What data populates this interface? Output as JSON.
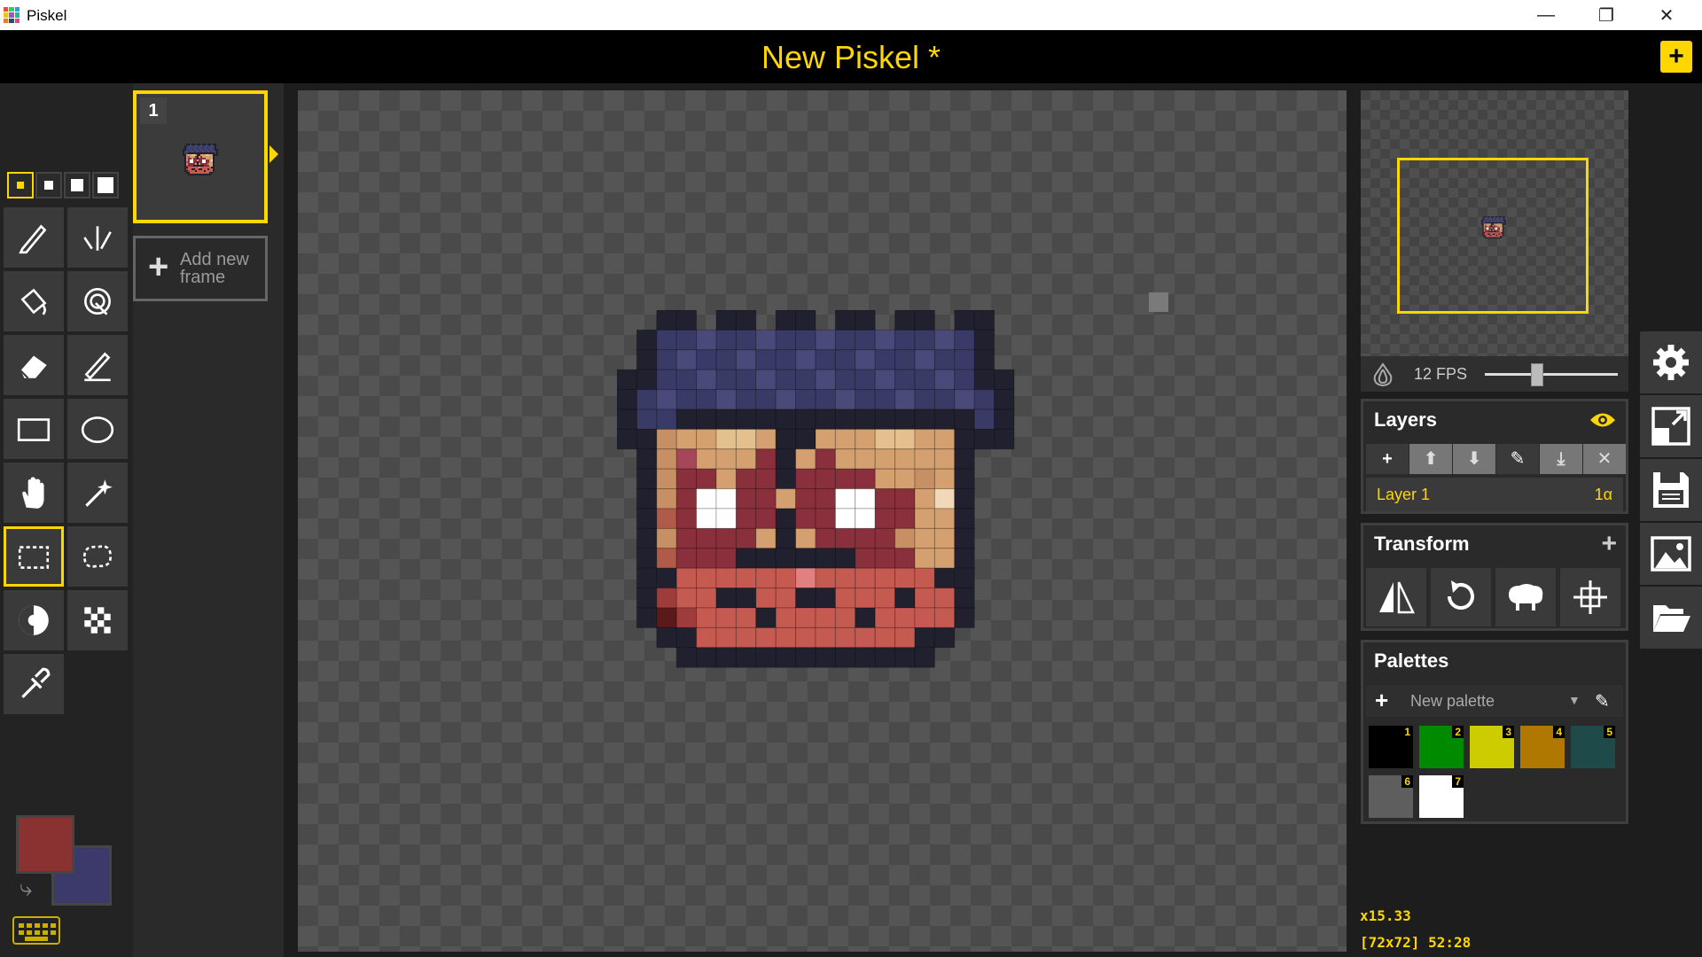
{
  "window": {
    "title": "Piskel",
    "controls": [
      "—",
      "❐",
      "✕"
    ]
  },
  "header": {
    "title": "New Piskel *",
    "new_button": "+"
  },
  "tools": {
    "pen_sizes": [
      1,
      2,
      3,
      4
    ],
    "selected_pen_size": 1,
    "items": [
      {
        "name": "pen-tool",
        "icon": "pen-icon"
      },
      {
        "name": "vertical-mirror-pen-tool",
        "icon": "mirror-pen-icon"
      },
      {
        "name": "paint-bucket-tool",
        "icon": "bucket-icon"
      },
      {
        "name": "paint-same-pixels-tool",
        "icon": "magic-bucket-icon"
      },
      {
        "name": "eraser-tool",
        "icon": "eraser-icon"
      },
      {
        "name": "stroke-tool",
        "icon": "stroke-icon"
      },
      {
        "name": "rectangle-tool",
        "icon": "rectangle-icon"
      },
      {
        "name": "circle-tool",
        "icon": "circle-icon"
      },
      {
        "name": "move-tool",
        "icon": "hand-icon"
      },
      {
        "name": "shape-selection-tool",
        "icon": "magic-wand-icon"
      },
      {
        "name": "rectangle-selection-tool",
        "icon": "rect-select-icon"
      },
      {
        "name": "lasso-selection-tool",
        "icon": "lasso-icon"
      },
      {
        "name": "lighten-tool",
        "icon": "lighten-icon"
      },
      {
        "name": "dithering-tool",
        "icon": "checker-icon"
      },
      {
        "name": "color-picker-tool",
        "icon": "eyedropper-icon"
      }
    ],
    "selected_tool": "rectangle-selection-tool",
    "primary_color": "#8a3232",
    "secondary_color": "#3b3a6b"
  },
  "frames": {
    "items": [
      {
        "number": "1"
      }
    ],
    "add_label_line1": "Add new",
    "add_label_line2": "frame"
  },
  "preview": {
    "fps_label": "12 FPS",
    "fps": 12
  },
  "layers": {
    "title": "Layers",
    "items": [
      {
        "name": "Layer 1",
        "opacity": "1α"
      }
    ]
  },
  "transform": {
    "title": "Transform",
    "tools": [
      "flip-icon",
      "rotate-icon",
      "clone-icon",
      "center-icon"
    ]
  },
  "palettes": {
    "title": "Palettes",
    "selected": "New palette",
    "colors": [
      {
        "n": "1",
        "hex": "#000000"
      },
      {
        "n": "2",
        "hex": "#008a00"
      },
      {
        "n": "3",
        "hex": "#cccc00"
      },
      {
        "n": "4",
        "hex": "#b07800"
      },
      {
        "n": "5",
        "hex": "#1f4a4a"
      },
      {
        "n": "6",
        "hex": "#5e5e5e"
      },
      {
        "n": "7",
        "hex": "#ffffff"
      }
    ]
  },
  "status": {
    "zoom": "x15.33",
    "cursor": "[72x72] 52:28"
  },
  "side_actions": [
    "settings-icon",
    "resize-icon",
    "save-icon",
    "export-image-icon",
    "open-folder-icon"
  ],
  "sprite": {
    "palette": {
      "K": "#20202f",
      "N": "#3a3a66",
      "M": "#4a4a7a",
      "S": "#d4a070",
      "T": "#c79064",
      "L": "#e3c08e",
      "R": "#8a2f3c",
      "P": "#a5465a",
      "W": "#ffffff",
      "O": "#b05a4a",
      "E": "#c45a50",
      "D": "#9e3c3c",
      "B": "#5a1a1a",
      "F": "#e28080",
      "G": "#f0d8b8"
    },
    "rows": [
      "..KK.KK.KK.KK.KK.KK..",
      ".KNNMNNMNNMNNMNNMNK.",
      ".KNMNNMNNMNNMNNMNNK.",
      "KKNNMNNMNNMNNMNNMNKK",
      "KNMNNMNNMNNMNNMNNMNK",
      "KNNKKKKKKKKKKKKKKKNK",
      "KKTSSLLSKKSSSLLSSKKK",
      ".KTPSSSRKSRSSSSSSK.",
      ".KTRRSRRKRRRRSSTSK.",
      ".KTRWWRRSRRWWRRSGK.",
      ".KORWWRRKRRWWRRSSK.",
      ".KTRRRRSKSRRRRTSSK.",
      ".KORRRKKKKKKRRRSSK.",
      ".KKEEEEEEFEEEEEEKK.",
      ".KDEEKKEEKKEEEKEEK.",
      ".KBDEEEKEEEEKEEEEK.",
      "..KKEEEEEEEEEEEKK..",
      "...KKKKKKKKKKKKK..."
    ]
  }
}
